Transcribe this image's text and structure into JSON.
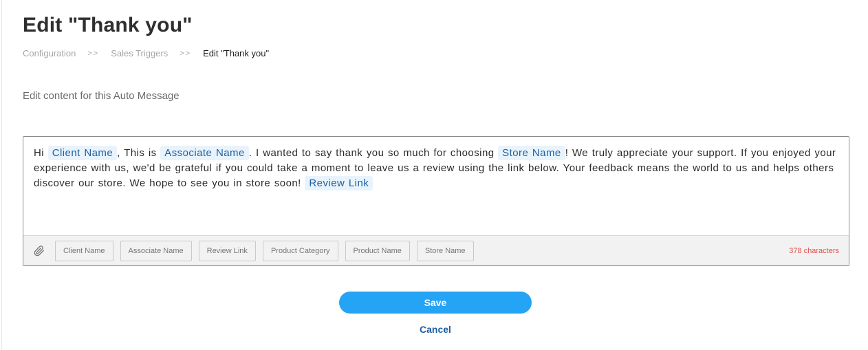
{
  "page": {
    "title": "Edit \"Thank you\"",
    "subtitle": "Edit content for this Auto Message"
  },
  "breadcrumb": {
    "items": [
      "Configuration",
      "Sales Triggers",
      "Edit \"Thank you\""
    ],
    "separator": ">>"
  },
  "message": {
    "segments": [
      {
        "type": "text",
        "value": "Hi "
      },
      {
        "type": "tag",
        "value": "Client Name"
      },
      {
        "type": "text",
        "value": ", This is "
      },
      {
        "type": "tag",
        "value": "Associate Name"
      },
      {
        "type": "text",
        "value": ". I wanted to say thank you so much for choosing "
      },
      {
        "type": "tag",
        "value": "Store Name"
      },
      {
        "type": "text",
        "value": "! We truly appreciate your support. If you enjoyed your experience with us, we'd be grateful if you could take a moment to leave us a review using the link below. Your feedback means the world to us and helps others discover our store. We hope to see you in store soon! "
      },
      {
        "type": "tag",
        "value": "Review Link"
      }
    ]
  },
  "toolbar": {
    "attach_icon": "paperclip-icon",
    "chips": [
      "Client Name",
      "Associate Name",
      "Review Link",
      "Product Category",
      "Product Name",
      "Store Name"
    ],
    "char_count": "378 characters"
  },
  "actions": {
    "save_label": "Save",
    "cancel_label": "Cancel"
  },
  "colors": {
    "primary": "#25a3f5",
    "link": "#1f5f9e",
    "tag_bg": "#e8f3fc",
    "warning": "#e0504a"
  }
}
